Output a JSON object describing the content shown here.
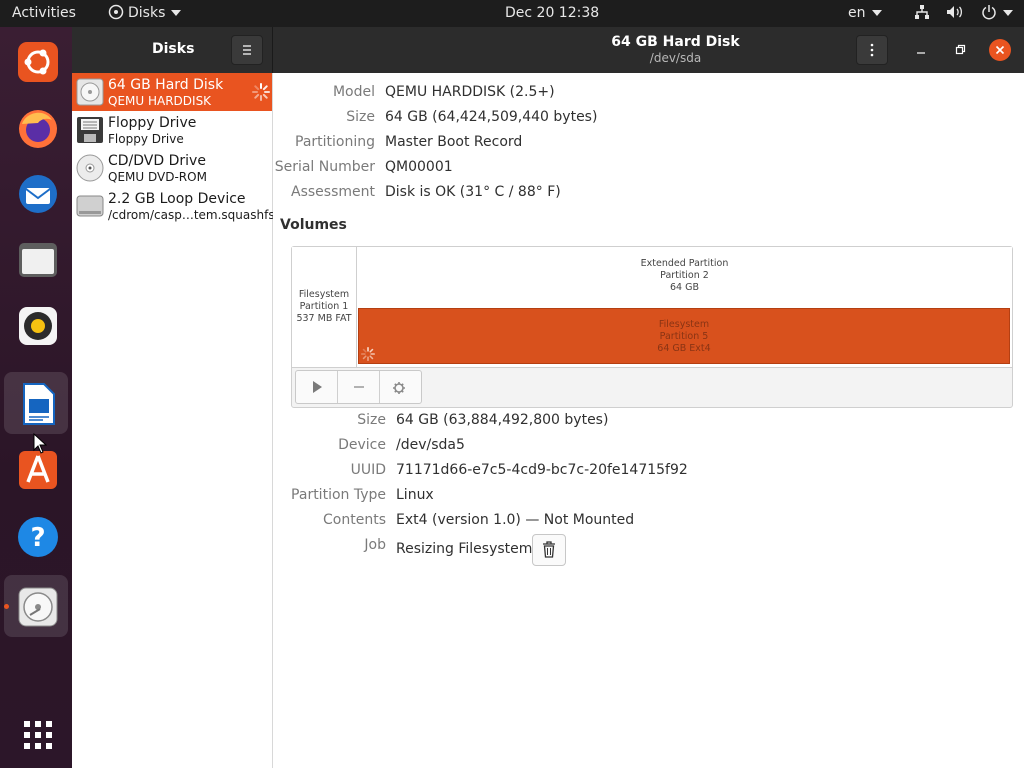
{
  "topbar": {
    "activities": "Activities",
    "app_menu": "Disks",
    "clock": "Dec 20  12:38",
    "input_source": "en"
  },
  "dock": {
    "items": [
      "ubuntu-software-icon",
      "firefox-icon",
      "thunderbird-icon",
      "files-icon",
      "rhythmbox-icon",
      "writer-icon",
      "software-center-icon",
      "help-icon",
      "disks-icon",
      "show-apps-icon"
    ]
  },
  "sidebar": {
    "title": "Disks",
    "drives": [
      {
        "name": "64 GB Hard Disk",
        "sub": "QEMU HARDDISK"
      },
      {
        "name": "Floppy Drive",
        "sub": "Floppy Drive"
      },
      {
        "name": "CD/DVD Drive",
        "sub": "QEMU DVD-ROM"
      },
      {
        "name": "2.2 GB Loop Device",
        "sub": "/cdrom/casp…tem.squashfs"
      }
    ]
  },
  "header": {
    "title": "64 GB Hard Disk",
    "subtitle": "/dev/sda"
  },
  "disk_info": {
    "model_label": "Model",
    "model": "QEMU HARDDISK (2.5+)",
    "size_label": "Size",
    "size": "64 GB (64,424,509,440 bytes)",
    "partitioning_label": "Partitioning",
    "partitioning": "Master Boot Record",
    "serial_label": "Serial Number",
    "serial": "QM00001",
    "assessment_label": "Assessment",
    "assessment": "Disk is OK (31° C / 88° F)"
  },
  "volumes": {
    "title": "Volumes",
    "p1": {
      "line1": "Filesystem",
      "line2": "Partition 1",
      "line3": "537 MB FAT"
    },
    "ext": {
      "line1": "Extended Partition",
      "line2": "Partition 2",
      "line3": "64 GB"
    },
    "p5": {
      "line1": "Filesystem",
      "line2": "Partition 5",
      "line3": "64 GB Ext4"
    }
  },
  "partition_info": {
    "size_label": "Size",
    "size": "64 GB (63,884,492,800 bytes)",
    "device_label": "Device",
    "device": "/dev/sda5",
    "uuid_label": "UUID",
    "uuid": "71171d66-e7c5-4cd9-bc7c-20fe14715f92",
    "type_label": "Partition Type",
    "type": "Linux",
    "contents_label": "Contents",
    "contents": "Ext4 (version 1.0) — Not Mounted",
    "job_label": "Job",
    "job": "Resizing Filesystem"
  },
  "colors": {
    "accent": "#e95420",
    "dock": "#2c1629",
    "header": "#2c2c2c"
  }
}
